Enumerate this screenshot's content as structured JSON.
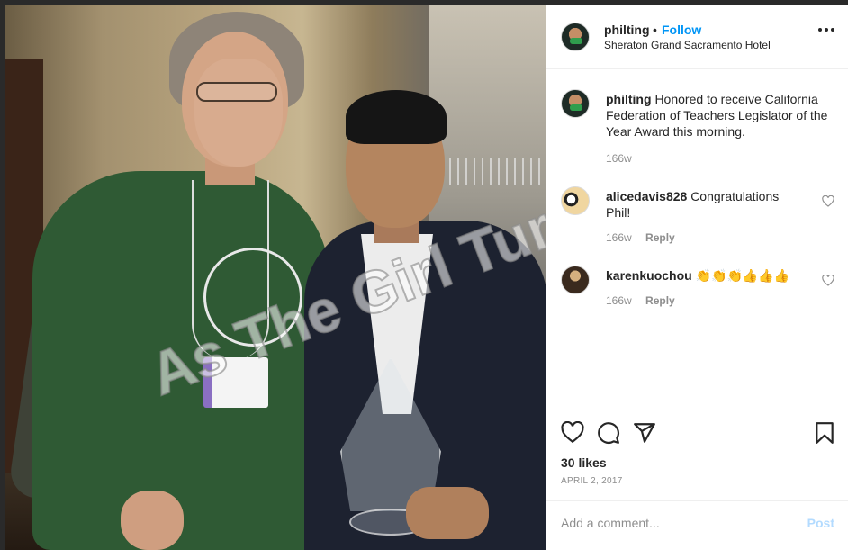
{
  "post": {
    "username": "philting",
    "separator": "•",
    "follow_label": "Follow",
    "location": "Sheraton Grand Sacramento Hotel",
    "more_icon": "more-horizontal-icon"
  },
  "photo": {
    "watermark": "As The Girl Turns, Inc."
  },
  "caption": {
    "username": "philting",
    "text": "Honored to receive California Federation of Teachers Legislator of the Year Award this morning.",
    "time": "166w"
  },
  "comments": [
    {
      "username": "alicedavis828",
      "text": "Congratulations Phil!",
      "time": "166w",
      "reply_label": "Reply"
    },
    {
      "username": "karenkuochou",
      "text": "👏👏👏👍👍👍",
      "time": "166w",
      "reply_label": "Reply"
    }
  ],
  "actions": {
    "icons": [
      "heart-icon",
      "comment-icon",
      "share-icon",
      "bookmark-icon"
    ],
    "likes": "30 likes",
    "date": "APRIL 2, 2017"
  },
  "add_comment": {
    "placeholder": "Add a comment...",
    "post_label": "Post"
  },
  "colors": {
    "accent": "#0095f6",
    "post_disabled": "#b3dbff",
    "muted": "#8e8e8e",
    "text": "#262626"
  }
}
